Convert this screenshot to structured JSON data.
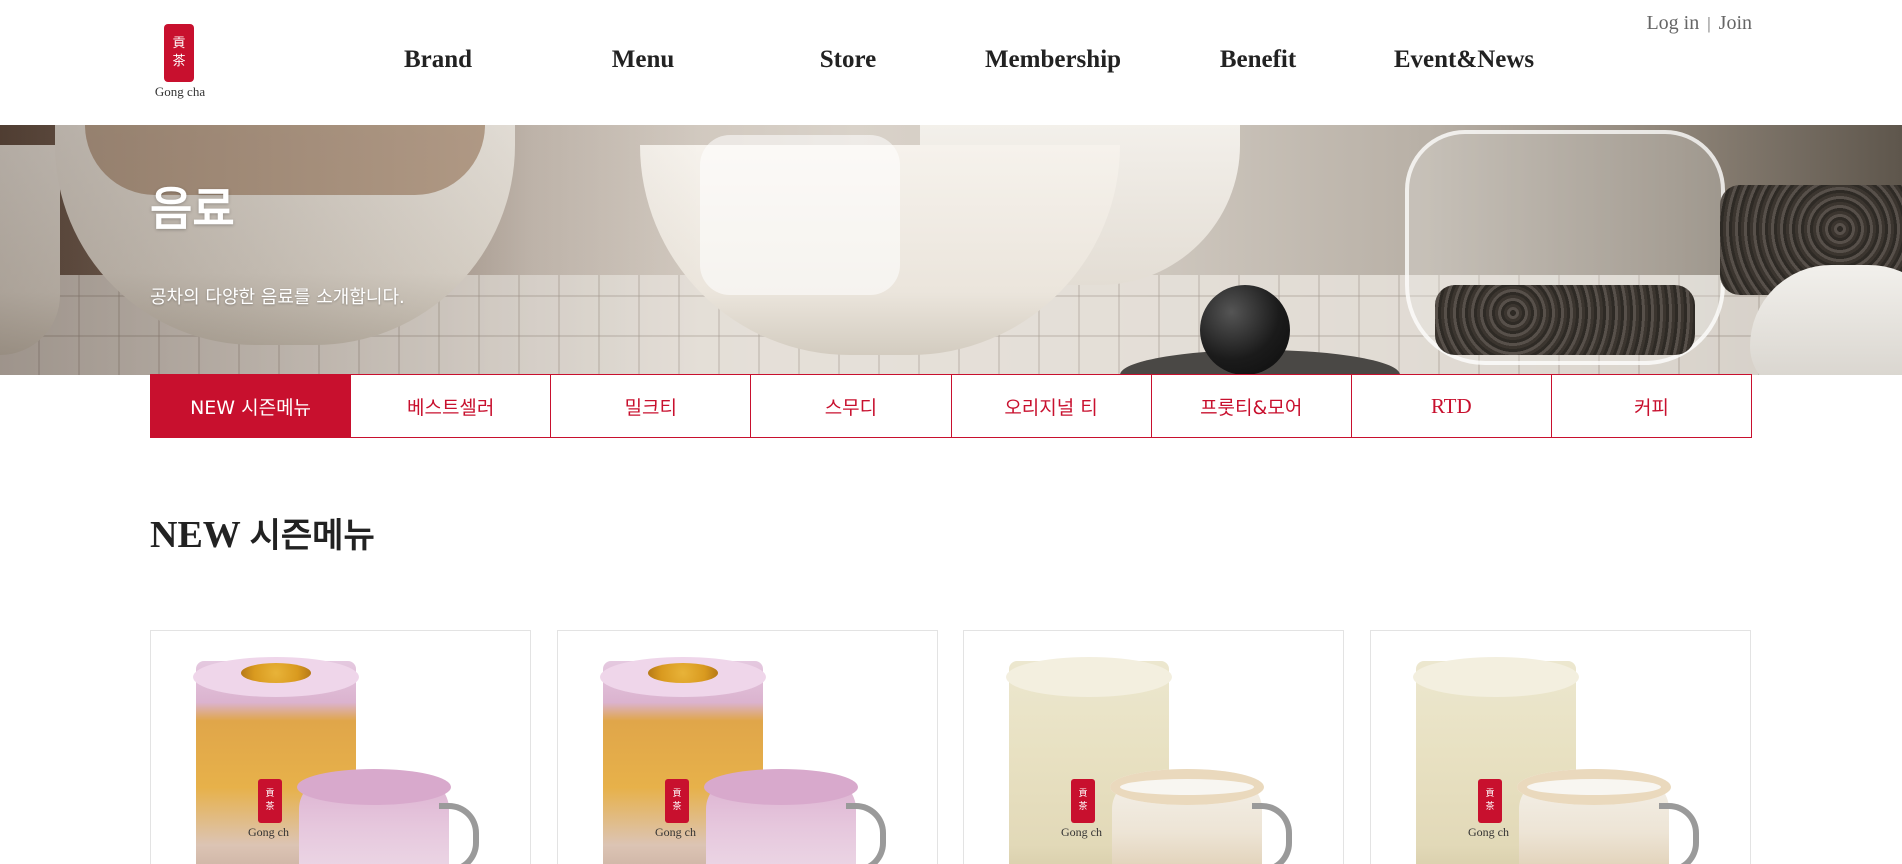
{
  "header": {
    "logo_text": "Gong cha",
    "logo_glyphs": [
      "貢",
      "茶"
    ],
    "nav": [
      {
        "label": "Brand"
      },
      {
        "label": "Menu"
      },
      {
        "label": "Store"
      },
      {
        "label": "Membership"
      },
      {
        "label": "Benefit"
      },
      {
        "label": "Event&News"
      }
    ],
    "util": {
      "login": "Log in",
      "separator": "|",
      "join": "Join"
    }
  },
  "hero": {
    "title": "음료",
    "description": "공차의 다양한 음료를 소개합니다."
  },
  "tabs": [
    {
      "label": "NEW 시즌메뉴",
      "active": true
    },
    {
      "label": "베스트셀러",
      "active": false
    },
    {
      "label": "밀크티",
      "active": false
    },
    {
      "label": "스무디",
      "active": false
    },
    {
      "label": "오리지널 티",
      "active": false
    },
    {
      "label": "프룻티&모어",
      "active": false
    },
    {
      "label": "RTD",
      "active": false
    },
    {
      "label": "커피",
      "active": false
    }
  ],
  "section": {
    "title_en": "NEW",
    "title_ko": "시즌메뉴"
  },
  "products": [
    {
      "style": "taro",
      "brand_text": "Gong ch"
    },
    {
      "style": "taro",
      "brand_text": "Gong ch"
    },
    {
      "style": "milk",
      "brand_text": "Gong ch"
    },
    {
      "style": "milk",
      "brand_text": "Gong ch"
    }
  ],
  "colors": {
    "brand_red": "#c8102e",
    "text_dark": "#222222",
    "util_gray": "#666666"
  }
}
